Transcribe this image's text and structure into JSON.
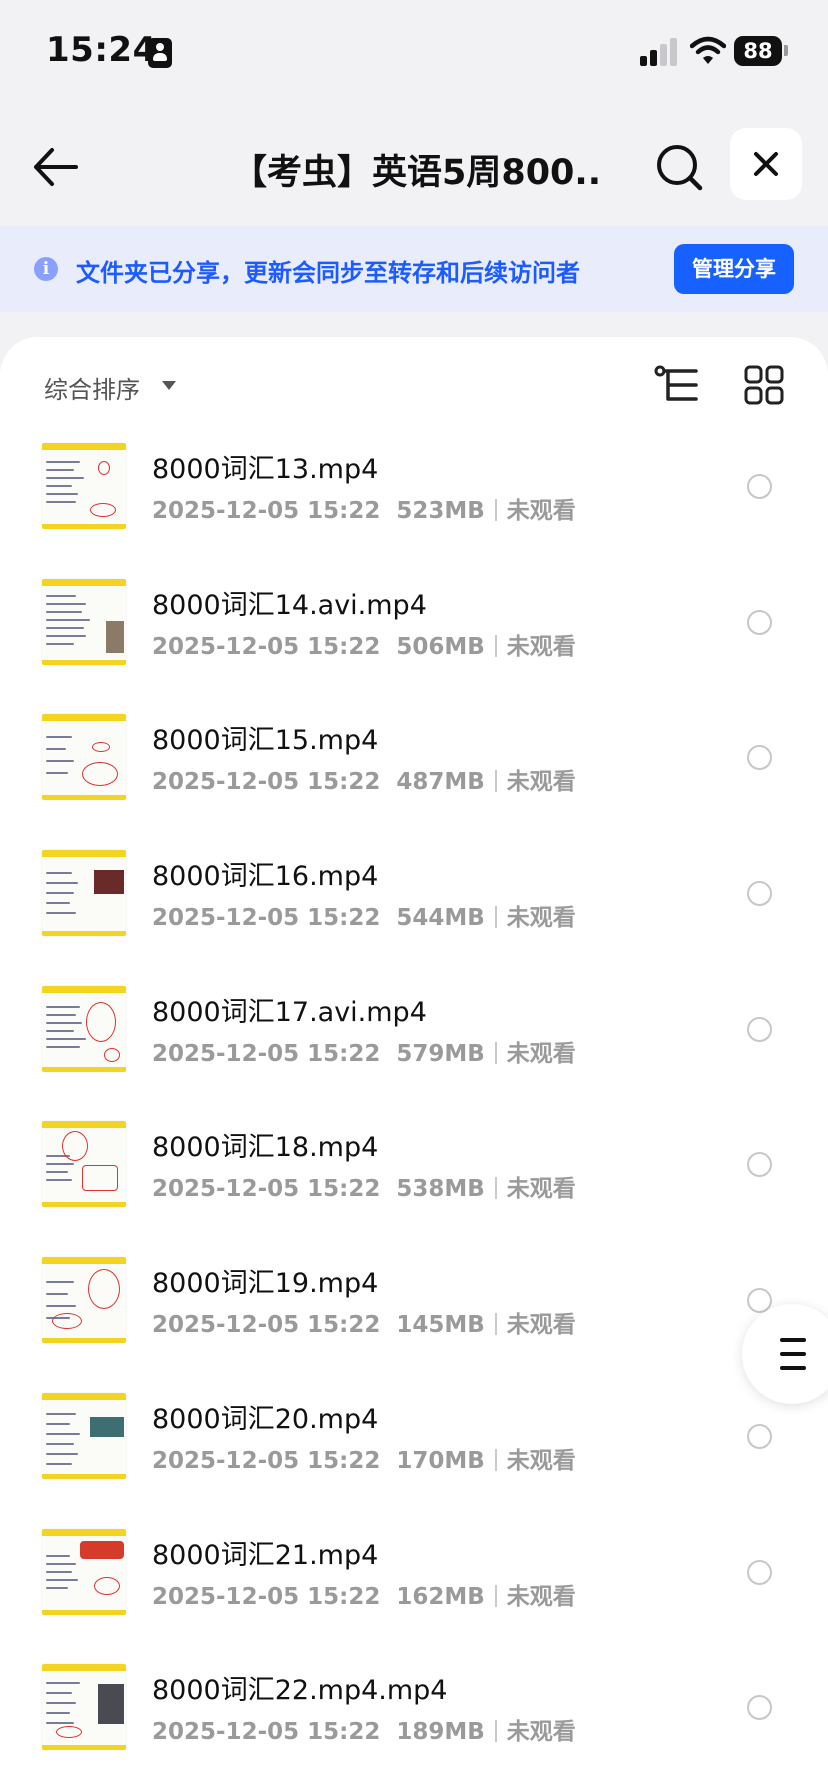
{
  "status_bar": {
    "time": "15:24",
    "battery": "88"
  },
  "nav": {
    "title": "【考虫】英语5周800..."
  },
  "banner": {
    "text": "文件夹已分享，更新会同步至转存和后续访问者",
    "manage_label": "管理分享"
  },
  "toolbar": {
    "sort_label": "综合排序"
  },
  "files": [
    {
      "name": "8000词汇13.mp4",
      "date": "2025-12-05 15:22",
      "size": "523MB",
      "status": "未观看"
    },
    {
      "name": "8000词汇14.avi.mp4",
      "date": "2025-12-05 15:22",
      "size": "506MB",
      "status": "未观看"
    },
    {
      "name": "8000词汇15.mp4",
      "date": "2025-12-05 15:22",
      "size": "487MB",
      "status": "未观看"
    },
    {
      "name": "8000词汇16.mp4",
      "date": "2025-12-05 15:22",
      "size": "544MB",
      "status": "未观看"
    },
    {
      "name": "8000词汇17.avi.mp4",
      "date": "2025-12-05 15:22",
      "size": "579MB",
      "status": "未观看"
    },
    {
      "name": "8000词汇18.mp4",
      "date": "2025-12-05 15:22",
      "size": "538MB",
      "status": "未观看"
    },
    {
      "name": "8000词汇19.mp4",
      "date": "2025-12-05 15:22",
      "size": "145MB",
      "status": "未观看"
    },
    {
      "name": "8000词汇20.mp4",
      "date": "2025-12-05 15:22",
      "size": "170MB",
      "status": "未观看"
    },
    {
      "name": "8000词汇21.mp4",
      "date": "2025-12-05 15:22",
      "size": "162MB",
      "status": "未观看"
    },
    {
      "name": "8000词汇22.mp4.mp4",
      "date": "2025-12-05 15:22",
      "size": "189MB",
      "status": "未观看"
    }
  ],
  "colors": {
    "accent": "#1661ff",
    "banner_bg": "#e9ecfb",
    "thumb_band": "#f3d421"
  },
  "icons": {
    "back": "arrow-left-icon",
    "search": "search-icon",
    "close": "close-icon",
    "info": "info-icon",
    "sort": "caret-down-icon",
    "tree": "tree-view-icon",
    "grid": "grid-view-icon",
    "menu": "menu-icon"
  }
}
